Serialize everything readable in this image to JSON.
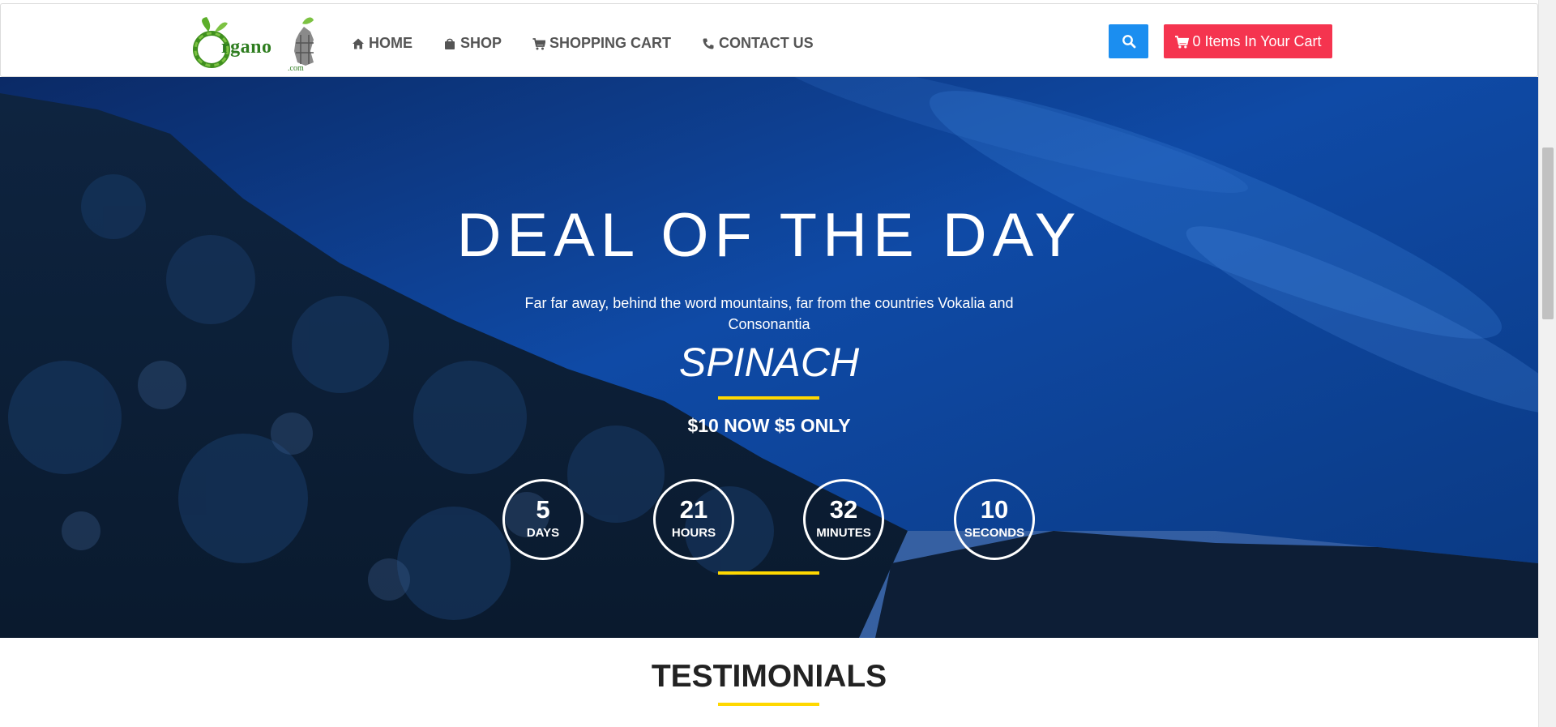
{
  "header": {
    "logo": {
      "text": "rgano",
      "sub": ".com",
      "initial": "O"
    },
    "nav": [
      {
        "label": "HOME",
        "icon": "home-icon"
      },
      {
        "label": "SHOP",
        "icon": "shopping-bag-icon"
      },
      {
        "label": "SHOPPING CART",
        "icon": "cart-icon"
      },
      {
        "label": "CONTACT US",
        "icon": "phone-icon"
      }
    ],
    "search_icon": "search-icon",
    "cart_button_label": "0 Items In Your Cart"
  },
  "hero": {
    "title": "DEAL OF THE DAY",
    "subtitle": "Far far away, behind the word mountains, far from the countries Vokalia and Consonantia",
    "product": "SPINACH",
    "price": "$10 NOW $5 ONLY",
    "countdown": [
      {
        "value": "5",
        "label": "DAYS"
      },
      {
        "value": "21",
        "label": "HOURS"
      },
      {
        "value": "32",
        "label": "MINUTES"
      },
      {
        "value": "10",
        "label": "SECONDS"
      }
    ]
  },
  "testimonials": {
    "title": "TESTIMONIALS"
  },
  "colors": {
    "search_button": "#1b8ef0",
    "cart_button": "#f5344f",
    "accent_line": "#ffd800",
    "logo_green": "#2e7d1f"
  }
}
